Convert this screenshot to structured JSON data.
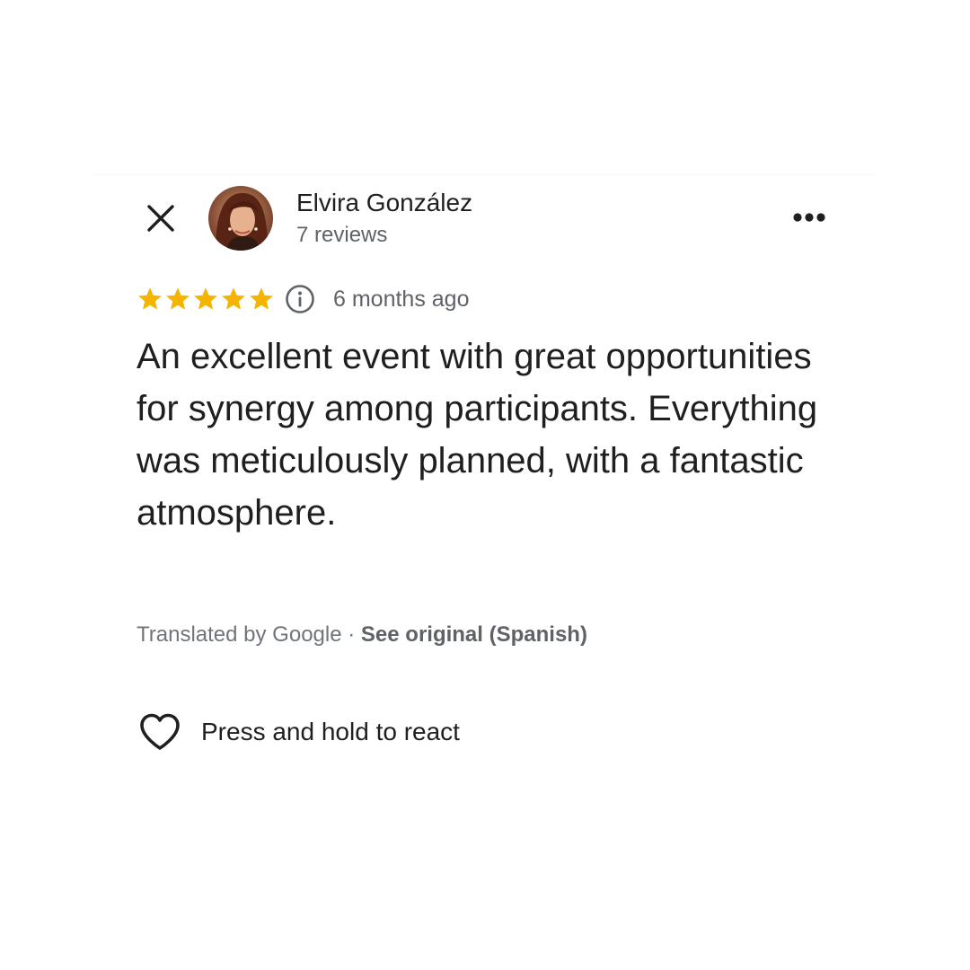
{
  "review": {
    "reviewer_name": "Elvira González",
    "review_count": "7 reviews",
    "rating": 5,
    "rating_max": 5,
    "time_ago": "6 months ago",
    "text": "An excellent event with great opportunities for synergy among participants. Everything was meticulously planned, with a fantastic atmosphere.",
    "translation": {
      "by_label": "Translated by Google",
      "separator": " · ",
      "see_original_label": "See original (Spanish)"
    },
    "react_label": "Press and hold to react"
  },
  "icons": {
    "close": "close-icon",
    "more": "more-options-icon",
    "star": "star-icon",
    "info": "info-icon",
    "heart": "heart-outline-icon"
  },
  "colors": {
    "star": "#f4b400",
    "primary_text": "#1f1f1f",
    "secondary_text": "#5f6368",
    "translation_text": "#70757a"
  }
}
